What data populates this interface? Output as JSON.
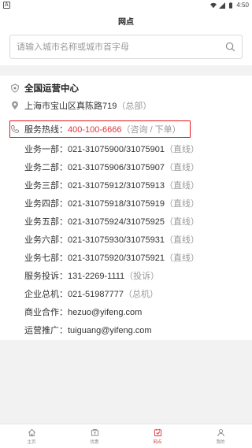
{
  "status_bar": {
    "app_letter": "A",
    "time": "4:50"
  },
  "header": {
    "title": "网点"
  },
  "search": {
    "placeholder": "请输入城市名称或城市首字母"
  },
  "center": {
    "title": "全国运营中心",
    "address": "上海市宝山区真陈路719",
    "address_note": "（总部）",
    "hotline_label": "服务热线：",
    "hotline_number": "400-100-6666",
    "hotline_note": "（咨询 / 下单）"
  },
  "contacts": [
    {
      "label": "业务一部：",
      "value": "021-31075900/31075901",
      "note": "（直线）"
    },
    {
      "label": "业务二部：",
      "value": "021-31075906/31075907",
      "note": "（直线）"
    },
    {
      "label": "业务三部：",
      "value": "021-31075912/31075913",
      "note": "（直线）"
    },
    {
      "label": "业务四部：",
      "value": "021-31075918/31075919",
      "note": "（直线）"
    },
    {
      "label": "业务五部：",
      "value": "021-31075924/31075925",
      "note": "（直线）"
    },
    {
      "label": "业务六部：",
      "value": "021-31075930/31075931",
      "note": "（直线）"
    },
    {
      "label": "业务七部：",
      "value": "021-31075920/31075921",
      "note": "（直线）"
    },
    {
      "label": "服务投诉：",
      "value": "131-2269-1111",
      "note": "（投诉）"
    },
    {
      "label": "企业总机：",
      "value": "021-51987777",
      "note": "（总机）"
    },
    {
      "label": "商业合作：",
      "value": "hezuo@yifeng.com",
      "note": ""
    },
    {
      "label": "运营推广：",
      "value": "tuiguang@yifeng.com",
      "note": ""
    }
  ],
  "tabbar": [
    {
      "label": "主页",
      "icon": "home-icon"
    },
    {
      "label": "优惠",
      "icon": "coupon-icon"
    },
    {
      "label": "网点",
      "icon": "outlet-icon",
      "active": true
    },
    {
      "label": "我的",
      "icon": "profile-icon"
    }
  ],
  "colors": {
    "accent": "#e5303a",
    "highlight_border": "#e4161c"
  }
}
